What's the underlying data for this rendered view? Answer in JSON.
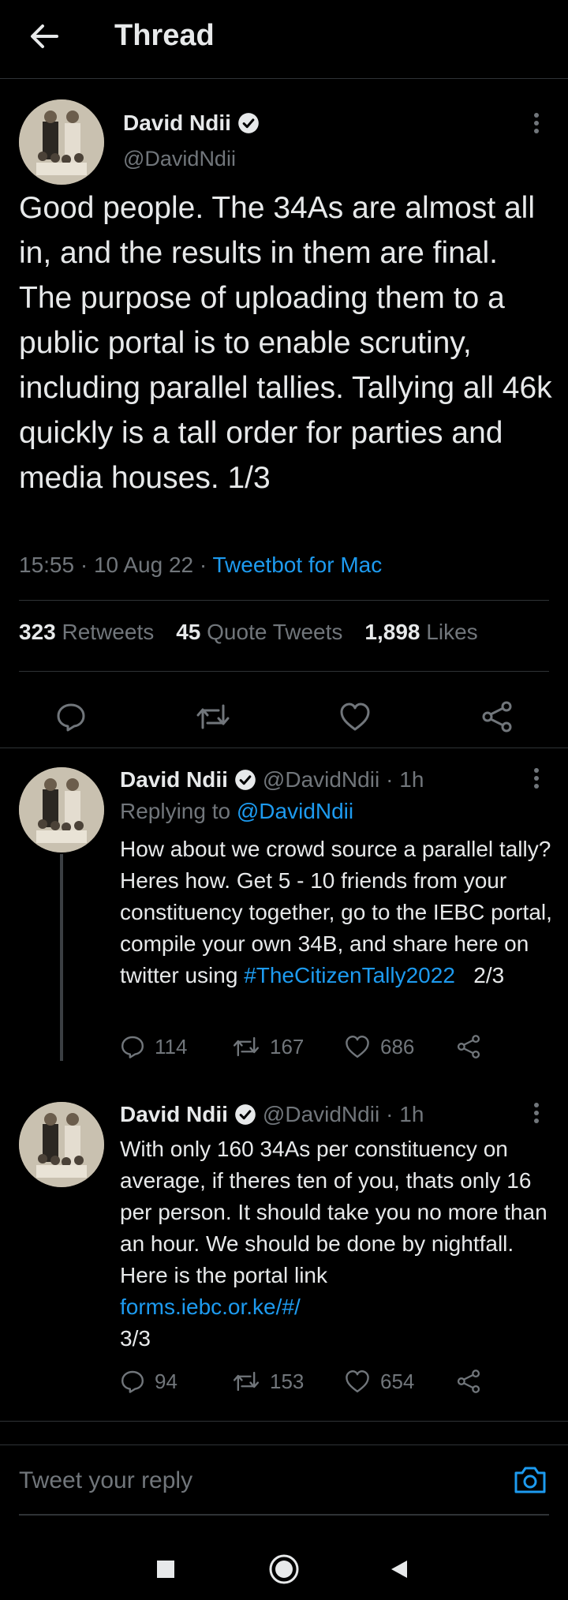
{
  "header": {
    "title": "Thread"
  },
  "main_tweet": {
    "name": "David Ndii",
    "handle": "@DavidNdii",
    "text": "Good people. The 34As are almost all in, and the results in them are final. The purpose of uploading them to a public portal is to enable scrutiny, including parallel tallies. Tallying all 46k quickly is a tall order for parties and media houses.   1/3",
    "time": "15:55",
    "date": "10 Aug 22",
    "source": "Tweetbot for Mac",
    "retweets_count": "323",
    "retweets_label": "Retweets",
    "quotes_count": "45",
    "quotes_label": "Quote Tweets",
    "likes_count": "1,898",
    "likes_label": "Likes"
  },
  "replies": [
    {
      "name": "David Ndii",
      "handle": "@DavidNdii",
      "time": "· 1h",
      "replying_prefix": "Replying to",
      "replying_handle": "@DavidNdii",
      "text_before": "How about we crowd source a parallel tally? Heres how. Get 5 - 10 friends from your constituency together, go to the IEBC portal, compile your own 34B, and share here on twitter using",
      "hashtag": "#TheCitizenTally2022",
      "text_after": "   2/3",
      "reply_count": "114",
      "retweet_count": "167",
      "like_count": "686"
    },
    {
      "name": "David Ndii",
      "handle": "@DavidNdii",
      "time": "· 1h",
      "text_before": "With only 160 34As per constituency on average, if theres ten of you, thats only 16 per person. It should take you no more than an hour. We should be done by nightfall.  Here is the portal link",
      "link": "forms.iebc.or.ke/#/",
      "text_after": "3/3",
      "reply_count": "94",
      "retweet_count": "153",
      "like_count": "654"
    }
  ],
  "compose": {
    "placeholder": "Tweet your reply"
  },
  "colors": {
    "accent": "#1d9bf0",
    "muted": "#71767b",
    "background": "#000000",
    "text": "#e7e9ea"
  }
}
